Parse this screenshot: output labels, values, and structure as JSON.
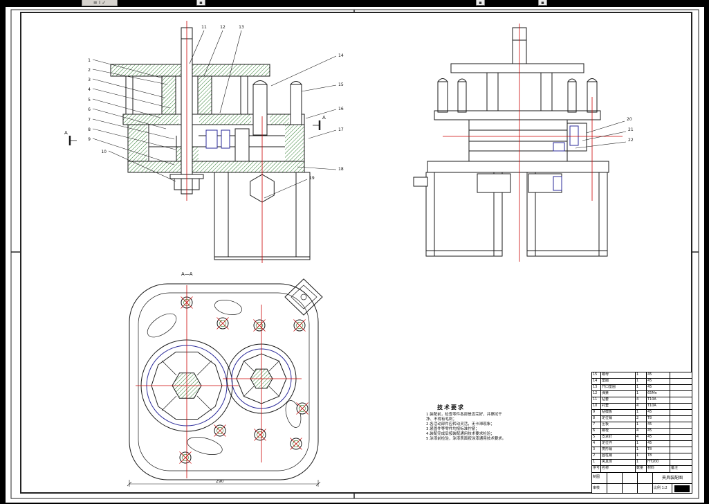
{
  "window": {
    "background": "#000000"
  },
  "toolbar": {
    "fragments": [
      {
        "glyphs": "≡ I ✓"
      },
      {
        "glyphs": "▪"
      },
      {
        "glyphs": "▪"
      },
      {
        "glyphs": "▪"
      }
    ]
  },
  "colors": {
    "paper": "#ffffff",
    "outline": "#1a1a1a",
    "centerline_red": "#cc0000",
    "hatch_green": "#2d7d2d",
    "detail_blue": "#2a2a9a"
  },
  "drawing": {
    "section_label": "A",
    "plan_view_label": "A—A",
    "plan_dimension": "290"
  },
  "callouts": {
    "left": [
      "1",
      "2",
      "3",
      "4",
      "5",
      "6",
      "7",
      "8",
      "9",
      "10"
    ],
    "top": [
      "11",
      "12",
      "13"
    ],
    "right": [
      "14",
      "15",
      "16",
      "17",
      "18",
      "19"
    ],
    "side": [
      "20",
      "21",
      "22"
    ]
  },
  "tech_requirements": {
    "title": "技术要求",
    "items": [
      "1.装配前，检查零件各部是否完好，并擦拭干净、不得有毛刺；",
      "2.各活动部件应转动灵活，无卡滞现象；",
      "3.紧固件等零件均按标准拧紧；",
      "4.装配完成后按装配通用技术要求检验；",
      "5.涂漆前检验，涂漆表面按涂漆通用技术要求。"
    ]
  },
  "bom": {
    "headers": {
      "no": "序号",
      "name": "名称",
      "qty": "数量",
      "mat": "材料",
      "note": "备注"
    },
    "rows": [
      {
        "no": "15",
        "name": "螺母",
        "qty": "1",
        "mat": "45",
        "note": ""
      },
      {
        "no": "14",
        "name": "垫圈",
        "qty": "1",
        "mat": "45",
        "note": ""
      },
      {
        "no": "13",
        "name": "开口垫圈",
        "qty": "1",
        "mat": "45",
        "note": ""
      },
      {
        "no": "12",
        "name": "弹簧",
        "qty": "1",
        "mat": "65Mn",
        "note": ""
      },
      {
        "no": "11",
        "name": "钻套",
        "qty": "4",
        "mat": "T10A",
        "note": ""
      },
      {
        "no": "10",
        "name": "衬套",
        "qty": "4",
        "mat": "T10A",
        "note": ""
      },
      {
        "no": "9",
        "name": "钻模板",
        "qty": "1",
        "mat": "45",
        "note": ""
      },
      {
        "no": "8",
        "name": "定位销",
        "qty": "2",
        "mat": "T8",
        "note": ""
      },
      {
        "no": "7",
        "name": "压板",
        "qty": "1",
        "mat": "45",
        "note": ""
      },
      {
        "no": "6",
        "name": "螺栓",
        "qty": "4",
        "mat": "45",
        "note": ""
      },
      {
        "no": "5",
        "name": "支承钉",
        "qty": "4",
        "mat": "45",
        "note": ""
      },
      {
        "no": "4",
        "name": "定位件",
        "qty": "1",
        "mat": "45",
        "note": ""
      },
      {
        "no": "3",
        "name": "菱形销",
        "qty": "1",
        "mat": "T8",
        "note": ""
      },
      {
        "no": "2",
        "name": "圆柱销",
        "qty": "1",
        "mat": "T8",
        "note": ""
      },
      {
        "no": "1",
        "name": "夹具体",
        "qty": "1",
        "mat": "HT200",
        "note": ""
      }
    ]
  },
  "title_block": {
    "drawing_title": "夹具装配图",
    "drafter_label": "制图",
    "checker_label": "审核",
    "scale_text": "比例 1:2"
  }
}
